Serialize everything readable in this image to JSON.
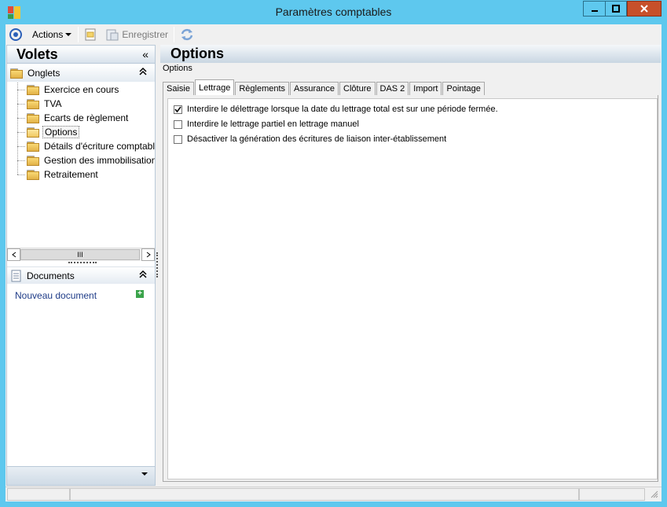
{
  "window": {
    "title": "Paramètres comptables"
  },
  "toolbar": {
    "actions_label": "Actions",
    "save_label": "Enregistrer"
  },
  "left_panel": {
    "title": "Volets",
    "collapse_glyph": "«",
    "group_onglets": "Onglets",
    "tree_items": [
      {
        "label": "Exercice en cours"
      },
      {
        "label": "TVA"
      },
      {
        "label": "Ecarts de règlement"
      },
      {
        "label": "Options",
        "selected": true
      },
      {
        "label": "Détails d'écriture comptable"
      },
      {
        "label": "Gestion des immobilisations"
      },
      {
        "label": "Retraitement"
      }
    ],
    "scroll_thumb": "III",
    "group_documents": "Documents",
    "new_document": "Nouveau document"
  },
  "right_panel": {
    "title": "Options",
    "breadcrumb": "Options",
    "tabs": [
      {
        "label": "Saisie"
      },
      {
        "label": "Lettrage",
        "active": true
      },
      {
        "label": "Règlements"
      },
      {
        "label": "Assurance"
      },
      {
        "label": "Clôture"
      },
      {
        "label": "DAS 2"
      },
      {
        "label": "Import"
      },
      {
        "label": "Pointage"
      }
    ],
    "options": [
      {
        "label": "Interdire le délettrage lorsque la date du lettrage total est sur une période fermée.",
        "checked": true
      },
      {
        "label": "Interdire le lettrage partiel en lettrage manuel",
        "checked": false
      },
      {
        "label": "Désactiver la génération des écritures de liaison inter-établissement",
        "checked": false
      }
    ]
  },
  "colors": {
    "titlebar": "#5ec8ee",
    "close_button": "#c7502a",
    "link": "#1f3c88"
  }
}
